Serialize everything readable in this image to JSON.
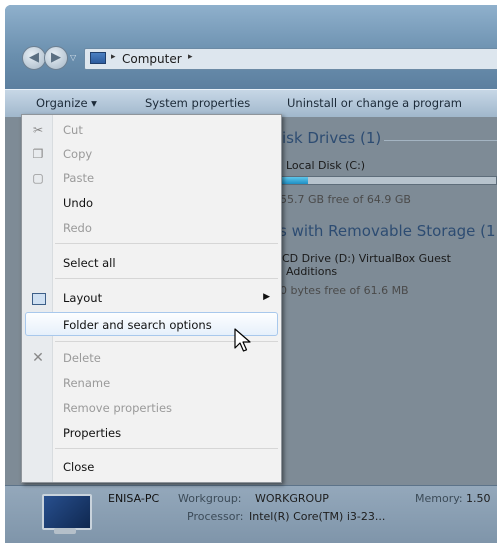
{
  "address": {
    "back_glyph": "◀",
    "forward_glyph": "▶",
    "recent_glyph": "▽",
    "separator_glyph": "▸",
    "breadcrumb": "Computer"
  },
  "toolbar": {
    "organize": "Organize ▾",
    "system_properties": "System properties",
    "uninstall": "Uninstall or change a program"
  },
  "content": {
    "hdd_header": "isk Drives (1)",
    "local_disk": "Local Disk (C:)",
    "local_disk_free": "55.7 GB free of 64.9 GB",
    "local_disk_used_fraction": 0.14,
    "removable_header": "s with Removable Storage (1",
    "cd_drive_line1": "CD Drive (D:) VirtualBox Guest",
    "cd_drive_line2": "Additions",
    "cd_drive_free": "0 bytes free of 61.6 MB"
  },
  "menu": {
    "cut": "Cut",
    "copy": "Copy",
    "paste": "Paste",
    "undo": "Undo",
    "redo": "Redo",
    "select_all": "Select all",
    "layout": "Layout",
    "folder_options": "Folder and search options",
    "delete": "Delete",
    "rename": "Rename",
    "remove_properties": "Remove properties",
    "properties": "Properties",
    "close": "Close"
  },
  "details": {
    "computer_name": "ENISA-PC",
    "workgroup_label": "Workgroup:",
    "workgroup_value": "WORKGROUP",
    "memory_label": "Memory:",
    "memory_value": "1.50",
    "processor_label": "Processor:",
    "processor_value": "Intel(R) Core(TM) i3-23..."
  },
  "icons": {
    "cut": "scissors-icon",
    "copy": "copy-icon",
    "paste": "paste-icon",
    "layout": "layout-icon",
    "delete": "delete-x-icon",
    "computer": "computer-icon",
    "folder": "computer-folder-icon"
  },
  "colors": {
    "menu_highlight_border": "#a8c8ec",
    "drive_bar_fill": "#1f8fc4",
    "section_header": "#2d4c72"
  }
}
